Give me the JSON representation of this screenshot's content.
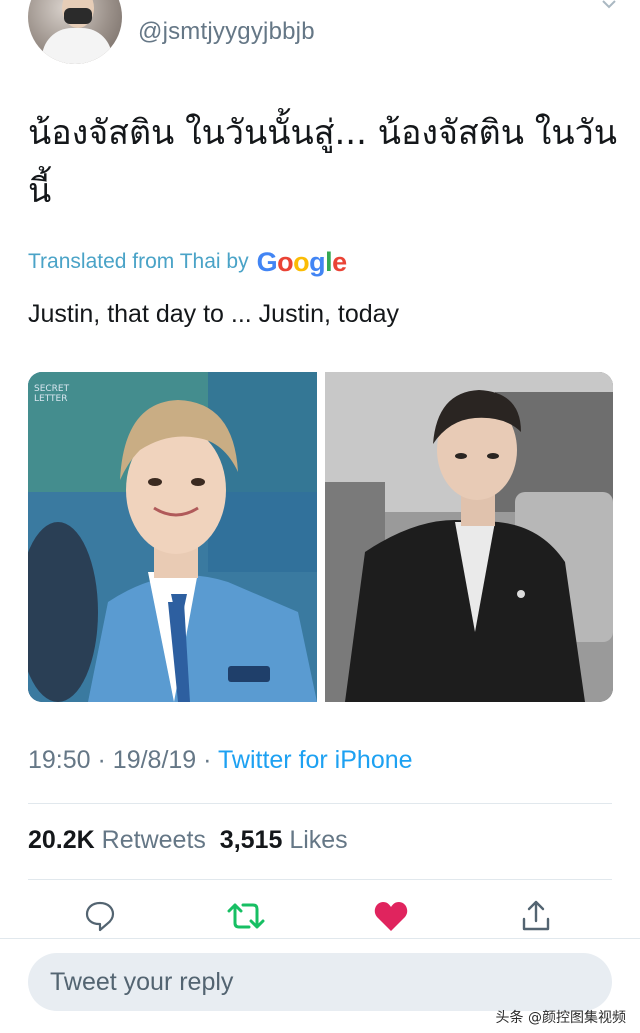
{
  "header": {
    "username": "@jsmtjyygyjbbjb"
  },
  "tweet": {
    "text": "น้องจัสติน ในวันนั้นสู่... น้องจัสติน ในวันนี้",
    "translated_label": "Translated from Thai by",
    "google_letters": [
      "G",
      "o",
      "o",
      "g",
      "l",
      "e"
    ],
    "translation": "Justin, that day to ... Justin, today",
    "photo_watermark": "SECRET LETTER",
    "time": "19:50",
    "date": "19/8/19",
    "separator": "·",
    "via": "Twitter for iPhone"
  },
  "stats": {
    "retweets_count": "20.2K",
    "retweets_label": "Retweets",
    "likes_count": "3,515",
    "likes_label": "Likes"
  },
  "actions": {
    "reply_icon": "speech-bubble-icon",
    "retweet_icon": "retweet-icon",
    "like_icon": "heart-icon",
    "share_icon": "share-icon",
    "retweet_color": "#17bf63",
    "like_color": "#e0245e"
  },
  "reply": {
    "placeholder": "Tweet your reply"
  },
  "watermark": {
    "text": "头条 @颜控图集视频"
  },
  "colors": {
    "link": "#1da1f2",
    "muted": "#657786",
    "translated": "#4aa3c7"
  }
}
